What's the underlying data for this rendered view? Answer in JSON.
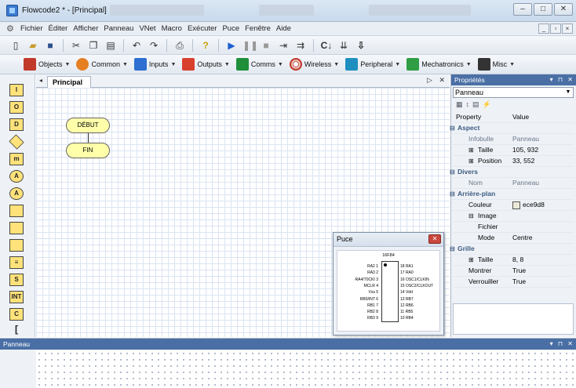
{
  "window": {
    "title": "Flowcode2 * - [Principal]"
  },
  "menu": {
    "items": [
      "Fichier",
      "Éditer",
      "Afficher",
      "Panneau",
      "VNet",
      "Macro",
      "Exécuter",
      "Puce",
      "Fenêtre",
      "Aide"
    ]
  },
  "toolbar2": {
    "items": [
      {
        "label": "Objects",
        "color": "#c0392b"
      },
      {
        "label": "Common",
        "color": "#e67e22"
      },
      {
        "label": "Inputs",
        "color": "#2e6fd1"
      },
      {
        "label": "Outputs",
        "color": "#d8402e"
      },
      {
        "label": "Comms",
        "color": "#1f8f3a"
      },
      {
        "label": "Wireless",
        "color": "#c0392b"
      },
      {
        "label": "Peripheral",
        "color": "#1f8fc0"
      },
      {
        "label": "Mechatronics",
        "color": "#2f9e44"
      },
      {
        "label": "Misc",
        "color": "#333333"
      }
    ]
  },
  "document": {
    "tab": "Principal"
  },
  "flowchart": {
    "start": "DÉBUT",
    "end": "FIN"
  },
  "puce": {
    "title": "Puce",
    "chip": "16F84",
    "left_pins": [
      "RA2 1",
      "RA3 2",
      "RA4/T0CKI 3",
      "MCLR 4",
      "Vss 5",
      "RB0/INT 6",
      "RB1 7",
      "RB2 8",
      "RB3 9"
    ],
    "right_pins": [
      "18 RA1",
      "17 RA0",
      "16 OSC1/CLKIN",
      "15 OSC2/CLKOUT",
      "14 Vdd",
      "13 RB7",
      "12 RB6",
      "11 RB5",
      "10 RB4"
    ]
  },
  "properties": {
    "header": "Propriétés",
    "selected": "Panneau",
    "col_property": "Property",
    "col_value": "Value",
    "rows": [
      {
        "name": "Aspect",
        "type": "cat"
      },
      {
        "name": "Infobulle",
        "value": "Panneau",
        "type": "muted"
      },
      {
        "name": "Taille",
        "value": "105, 932",
        "type": "expand"
      },
      {
        "name": "Position",
        "value": "33, 552",
        "type": "expand"
      },
      {
        "name": "Divers",
        "type": "cat"
      },
      {
        "name": "Nom",
        "value": "Panneau",
        "type": "muted"
      },
      {
        "name": "Arrière-plan",
        "type": "cat"
      },
      {
        "name": "Couleur",
        "value": "ece9d8",
        "type": "color"
      },
      {
        "name": "Image",
        "type": "subcat"
      },
      {
        "name": "Fichier",
        "value": "",
        "type": "sub"
      },
      {
        "name": "Mode",
        "value": "Centre",
        "type": "sub"
      },
      {
        "name": "Grille",
        "type": "cat"
      },
      {
        "name": "Taille",
        "value": "8, 8",
        "type": "expand"
      },
      {
        "name": "Montrer",
        "value": "True",
        "type": "plain"
      },
      {
        "name": "Verrouiller",
        "value": "True",
        "type": "plain"
      }
    ]
  },
  "bottom_panel": {
    "title": "Panneau"
  }
}
